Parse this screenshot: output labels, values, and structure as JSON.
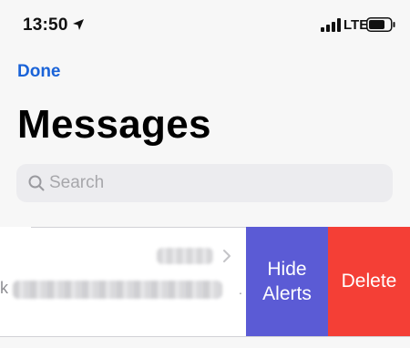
{
  "status_bar": {
    "time": "13:50",
    "network": "LTE",
    "icons": [
      "location-arrow-icon",
      "signal-bars-icon",
      "battery-icon"
    ]
  },
  "nav": {
    "done_label": "Done",
    "title": "Messages"
  },
  "search": {
    "placeholder": "Search",
    "value": ""
  },
  "messages": [
    {
      "sender": "",
      "date": "",
      "preview_lead": "k",
      "preview_trail": "."
    }
  ],
  "swipe_actions": {
    "hide_alerts_label": "Hide Alerts",
    "delete_label": "Delete"
  },
  "colors": {
    "accent": "#1a63d8",
    "hide_alerts": "#5b5bd5",
    "delete": "#f43f36",
    "background": "#f7f7f7"
  }
}
